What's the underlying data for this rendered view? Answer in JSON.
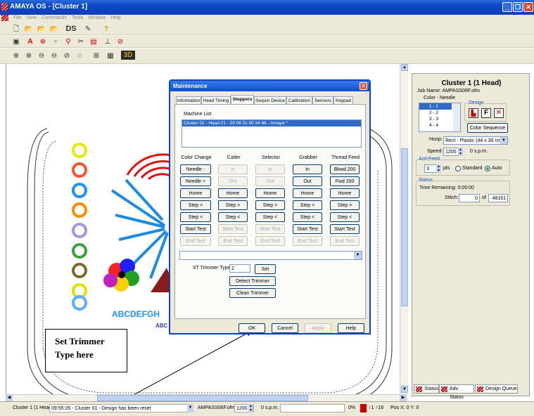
{
  "window": {
    "title": "AMAYA OS - [Cluster 1]"
  },
  "menu": [
    "File",
    "View",
    "Commands",
    "Tools",
    "Window",
    "Help"
  ],
  "toolbar": {
    "ds_label": "DS",
    "btn3d_label": "3D"
  },
  "canvas": {
    "letters": "ABCDEFGH",
    "letters2": "ABC"
  },
  "callout": {
    "line1": "Set Trimmer",
    "line2": "Type here"
  },
  "dialog": {
    "title": "Maintenance",
    "tabs": [
      "Information",
      "Head Timing",
      "Steppers",
      "Sequin Device",
      "Calibration",
      "Sensors",
      "Keypad"
    ],
    "active_tab": "Steppers",
    "machine_list_label": "Machine List",
    "machine_list_item": "Cluster 01 - Head 01 - 00 06 0c 00 34 66 - Amaya *",
    "columns": [
      "Color Change",
      "Cutter",
      "Selector",
      "Grabber",
      "Thread Feed"
    ],
    "rows": [
      [
        "Needle -",
        "In",
        "In",
        "In",
        "Bkwd 200"
      ],
      [
        "Needle +",
        "Out",
        "Out",
        "Out",
        "Fwd 200"
      ],
      [
        "Home",
        "Home",
        "Home",
        "Home",
        "Home"
      ],
      [
        "Step >",
        "Step >",
        "Step >",
        "Step >",
        "Step >"
      ],
      [
        "Step <",
        "Step <",
        "Step <",
        "Step <",
        "Step <"
      ],
      [
        "Start Test",
        "Start Test",
        "Start Test",
        "Start Test",
        "Start Test"
      ],
      [
        "End Test",
        "End Test",
        "End Test",
        "End Test",
        "End Test"
      ]
    ],
    "trimmer_label": "XT Trimmer Type:",
    "trimmer_value": "2",
    "set_label": "Set",
    "detect_label": "Detect Trimmer",
    "clean_label": "Clean Trimmer",
    "ok_label": "OK",
    "cancel_label": "Cancel",
    "apply_label": "Apply",
    "help_label": "Help"
  },
  "panel": {
    "title": "Cluster 1 (1 Head)",
    "job_name": "Job Name: AMPASS06F.ofm",
    "color_needle_label": "Color - Needle",
    "color_list": [
      "1 - 1",
      "2 - 2",
      "3 - 3",
      "4 - 4"
    ],
    "design_label": "Design",
    "color_sequence_label": "Color Sequence",
    "hoop_label": "Hoop:",
    "hoop_value": "Rect - Plastic (44 x 30 cm)",
    "speed_label": "Speed:",
    "speed_value": "1200",
    "speed_unit": "0 s.p.m.",
    "actifeed_label": "Acti-Feed",
    "actifeed_value": "3",
    "pts_label": "pts",
    "standard_label": "Standard",
    "auto_label": "Auto",
    "status_label": "Status",
    "time_remaining": "Time Remaining:  0:00:00",
    "stitch_label": "Stitch:",
    "stitch_value": "0",
    "of_label": "of",
    "stitch_total": "48161"
  },
  "bottom_tabs": [
    "Status",
    "Adv. Status",
    "Design Queue"
  ],
  "statusbar": {
    "cluster": "Cluster 1 (1 Head)",
    "message": "09:55:26 - Cluster 01 - Design has been reset",
    "file": "AMPASS06F.ofm",
    "speed": "1200",
    "spm": "0 s.p.m.",
    "percent": "0%",
    "needle": "1",
    "count": "16",
    "pos": "Pos X:   0 Y:   0"
  },
  "colors": {
    "accent": "#0a46c8",
    "selection": "#316ac5"
  }
}
